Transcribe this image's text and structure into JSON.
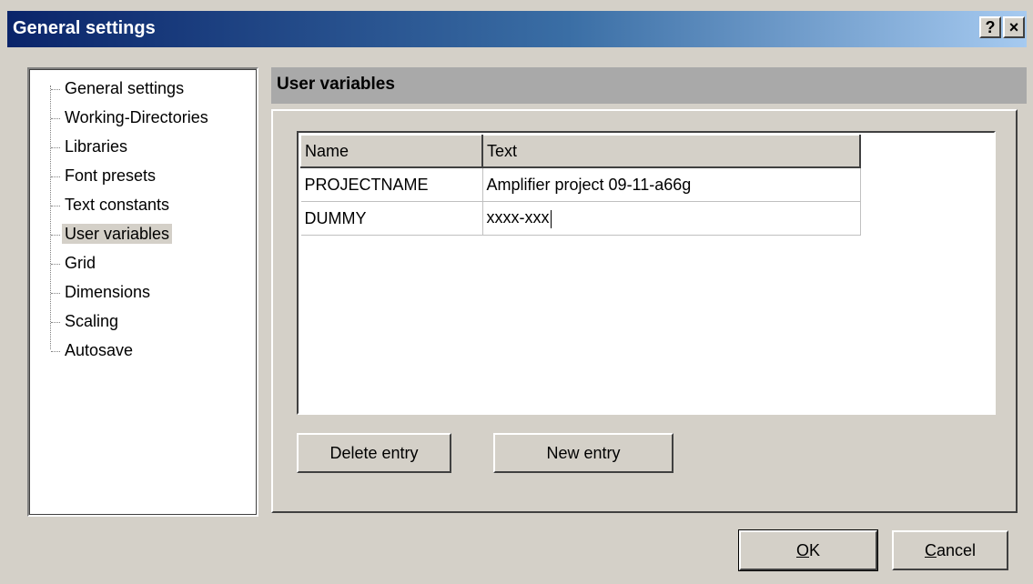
{
  "window": {
    "title": "General settings",
    "help_label": "?",
    "close_label": "×"
  },
  "tree": {
    "items": [
      {
        "label": "General settings"
      },
      {
        "label": "Working-Directories"
      },
      {
        "label": "Libraries"
      },
      {
        "label": "Font presets"
      },
      {
        "label": "Text constants"
      },
      {
        "label": "User variables",
        "selected": true
      },
      {
        "label": "Grid"
      },
      {
        "label": "Dimensions"
      },
      {
        "label": "Scaling"
      },
      {
        "label": "Autosave"
      }
    ]
  },
  "section": {
    "title": "User variables"
  },
  "table": {
    "headers": {
      "name": "Name",
      "text": "Text"
    },
    "rows": [
      {
        "name": "PROJECTNAME",
        "text": "Amplifier project 09-11-a66g"
      },
      {
        "name": "DUMMY",
        "text": "xxxx-xxx"
      }
    ]
  },
  "buttons": {
    "delete_entry": "Delete entry",
    "new_entry": "New entry",
    "ok_mnemonic": "O",
    "ok_rest": "K",
    "cancel_mnemonic": "C",
    "cancel_rest": "ancel"
  },
  "colors": {
    "titlebar_start": "#0a246a",
    "titlebar_end": "#a6caf0",
    "dialog_background": "#d4d0c8",
    "section_header": "#a9a9a9"
  }
}
